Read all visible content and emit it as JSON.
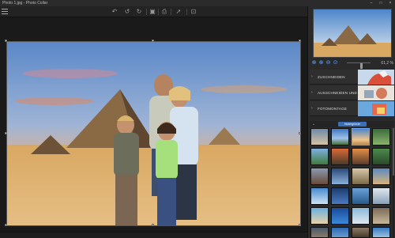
{
  "window": {
    "title": "Photo 1.jpg - Photo Collar",
    "minimize_icon": "minimize-icon",
    "maximize_icon": "maximize-icon",
    "close_icon": "close-icon"
  },
  "toolbar": {
    "icons": [
      "undo-all-icon",
      "undo-icon",
      "redo-icon",
      "save-icon",
      "print-icon",
      "share-icon",
      "crop-view-icon"
    ]
  },
  "preview": {
    "zoom_value": "61,2 %",
    "zoom_level": 0.612
  },
  "sections": [
    {
      "label": "ZUSCHNEIDEN"
    },
    {
      "label": "AUSSCHNEIDEN UND ERSETZEN"
    },
    {
      "label": "FOTOMONTAGE"
    }
  ],
  "backgrounds": {
    "tab_label": "Hintergründe"
  },
  "colors": {
    "accent": "#3a6fb8",
    "highlight": "#6aa4ff",
    "panel": "#2a2a2a",
    "canvas": "#1a1a1a"
  }
}
